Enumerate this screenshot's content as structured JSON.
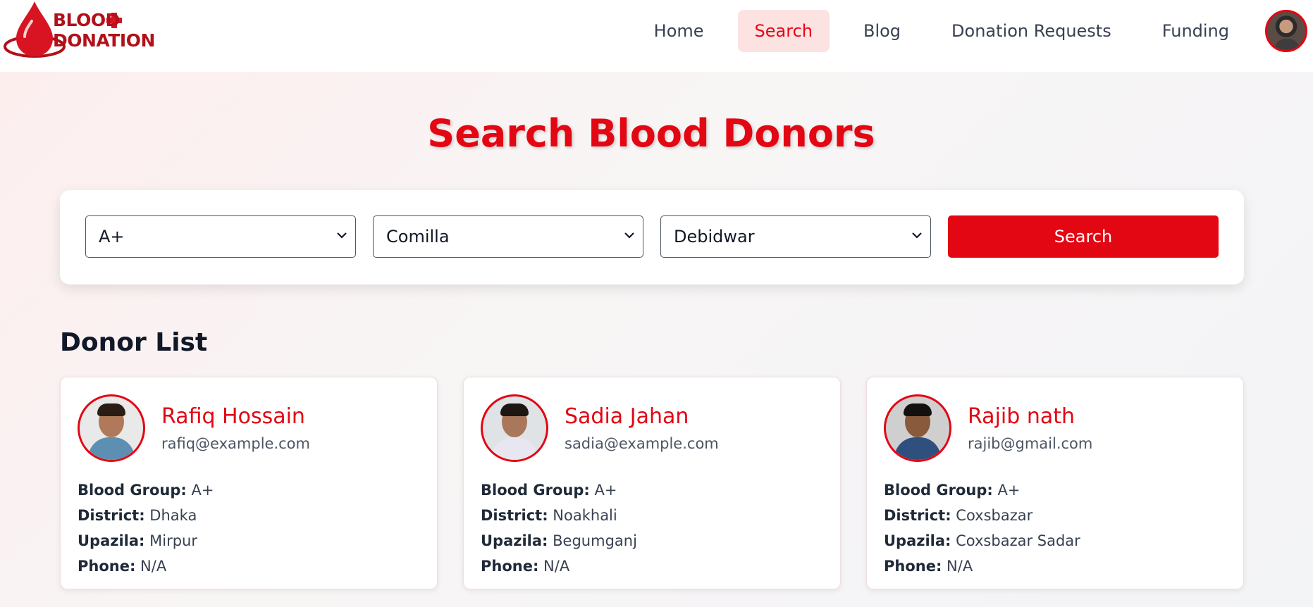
{
  "brand": {
    "line1": "BLOOD",
    "line2": "DONATION",
    "primary_color": "#e30613"
  },
  "nav": {
    "items": [
      {
        "label": "Home",
        "active": false
      },
      {
        "label": "Search",
        "active": true
      },
      {
        "label": "Blog",
        "active": false
      },
      {
        "label": "Donation Requests",
        "active": false
      },
      {
        "label": "Funding",
        "active": false
      }
    ]
  },
  "page": {
    "title": "Search Blood Donors"
  },
  "search": {
    "blood_group": "A+",
    "district": "Comilla",
    "upazila": "Debidwar",
    "button_label": "Search"
  },
  "donor_list": {
    "title": "Donor List",
    "labels": {
      "blood_group": "Blood Group:",
      "district": "District:",
      "upazila": "Upazila:",
      "phone": "Phone:"
    },
    "donors": [
      {
        "name": "Rafiq Hossain",
        "email": "rafiq@example.com",
        "blood_group": "A+",
        "district": "Dhaka",
        "upazila": "Mirpur",
        "phone": "N/A"
      },
      {
        "name": "Sadia Jahan",
        "email": "sadia@example.com",
        "blood_group": "A+",
        "district": "Noakhali",
        "upazila": "Begumganj",
        "phone": "N/A"
      },
      {
        "name": "Rajib nath",
        "email": "rajib@gmail.com",
        "blood_group": "A+",
        "district": "Coxsbazar",
        "upazila": "Coxsbazar Sadar",
        "phone": "N/A"
      }
    ]
  }
}
